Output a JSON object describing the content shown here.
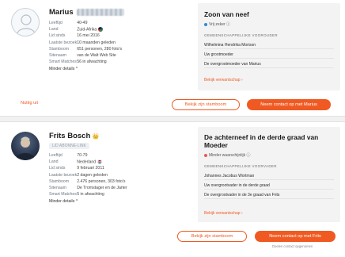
{
  "match1": {
    "name": "Marius",
    "labels": {
      "born": "Leeftijd",
      "country": "Land",
      "since": "Lid sinds",
      "last_visit": "Laatste bezoek",
      "family_tree": "Stamboom",
      "site": "Sitenaam",
      "smart": "Smart Matches"
    },
    "values": {
      "born": "40-49",
      "country": "Zuid-Afrika",
      "since": "16 mei 2016",
      "last_visit": "10 maanden geleden",
      "family_tree": "651 personen, 280 foto's",
      "site": "van de Walt Web Site",
      "smart": "56 in afwachting"
    },
    "more_details": "Minder details ^",
    "panel": {
      "title": "Zoon van neef",
      "confidence": "Vrij zeker ⓘ",
      "section": "GEMEENSCHAPPELIJKE VOOROUDER",
      "ancestor": "Wilhelmina Hendrika Morison",
      "rel1": "Uw grootmoeder",
      "rel2": "De overgrootmoeder van Marius",
      "details_link": "Bekijk verwantschap ›"
    },
    "footer": {
      "not_useful": "Nuttig uit",
      "view_tree": "Bekijk zijn stamboom",
      "contact": "Neem contact op met Marius"
    }
  },
  "match2": {
    "name": "Frits Bosch",
    "crown": "👑",
    "tag": "LID ABONNE-LINK",
    "labels": {
      "born": "Leeftijd",
      "country": "Land",
      "since": "Lid sinds",
      "last_visit": "Laatste bezoek",
      "family_tree": "Stamboom",
      "site": "Sitenaam",
      "smart": "Smart Matches"
    },
    "values": {
      "born": "70-79",
      "country": "Nederland",
      "since": "9 februari 2011",
      "last_visit": "2 dagen geleden",
      "family_tree": "2.476 personen, 303 foto's",
      "site": "De Tromstager en de Jarter",
      "smart": "5 in afwachting"
    },
    "more_details": "Minder details ^",
    "panel": {
      "title": "De achterneef in de derde graad van Moeder",
      "confidence": "Minder waarschijnlijk ⓘ",
      "section": "GEMEENSCHAPPELIJKE VOORVADER",
      "ancestor": "Johannes Jacobus Wortman",
      "rel1": "Uw overgrootvader in de derde graad",
      "rel2": "De overgrootvader in de 3e graad van Frits",
      "details_link": "Bekijk verwantschap ›"
    },
    "footer": {
      "view_tree": "Bekijk zijn stamboom",
      "contact": "Neem contact op met Frits",
      "note": "Doelen contact opgenomen"
    }
  },
  "colors": {
    "accent": "#f05a22",
    "confidence_high": "#2e8bd6",
    "confidence_low": "#e35b5b",
    "panel_bg": "#f3f3f3"
  }
}
